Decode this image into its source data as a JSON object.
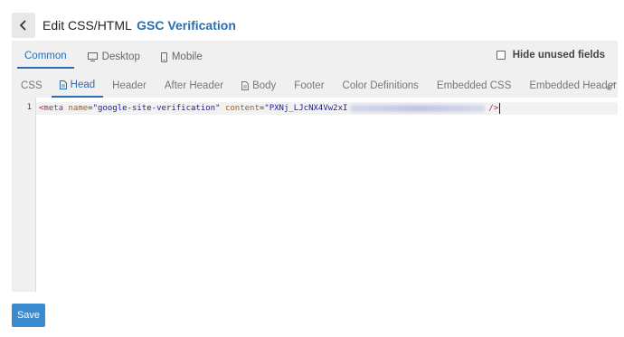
{
  "header": {
    "title": "Edit CSS/HTML",
    "accent": "GSC Verification"
  },
  "device_tabs": [
    {
      "label": "Common",
      "active": true,
      "icon": ""
    },
    {
      "label": "Desktop",
      "active": false,
      "icon": "monitor-icon"
    },
    {
      "label": "Mobile",
      "active": false,
      "icon": "phone-icon"
    }
  ],
  "hide_unused": {
    "label": "Hide unused fields",
    "checked": false
  },
  "file_tabs": [
    {
      "label": "CSS",
      "active": false,
      "icon": ""
    },
    {
      "label": "Head",
      "active": true,
      "icon": "file-icon"
    },
    {
      "label": "Header",
      "active": false,
      "icon": ""
    },
    {
      "label": "After Header",
      "active": false,
      "icon": ""
    },
    {
      "label": "Body",
      "active": false,
      "icon": "file-icon"
    },
    {
      "label": "Footer",
      "active": false,
      "icon": ""
    },
    {
      "label": "Color Definitions",
      "active": false,
      "icon": ""
    },
    {
      "label": "Embedded CSS",
      "active": false,
      "icon": ""
    },
    {
      "label": "Embedded Header",
      "active": false,
      "icon": ""
    }
  ],
  "editor": {
    "line_number": "1",
    "code": {
      "open": "<meta",
      "attr1": "name",
      "eq1": "=",
      "val1": "\"google-site-verification\"",
      "attr2": "content",
      "eq2": "=",
      "val2": "\"PXNj_LJcNX4Vw2xI",
      "close": "/>"
    }
  },
  "save": {
    "label": "Save"
  },
  "colors": {
    "accent": "#2a6db0",
    "save_button": "#3a8ad0",
    "panel": "#f0f0f0"
  }
}
